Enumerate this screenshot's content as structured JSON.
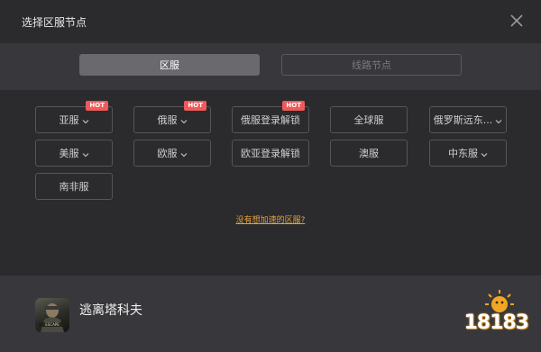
{
  "dialog": {
    "title": "选择区服节点"
  },
  "tabs": [
    {
      "label": "区服",
      "active": true
    },
    {
      "label": "线路节点",
      "active": false
    }
  ],
  "regions": [
    {
      "label": "亚服",
      "dropdown": true,
      "hot": true
    },
    {
      "label": "俄服",
      "dropdown": true,
      "hot": true
    },
    {
      "label": "俄服登录解锁",
      "dropdown": false,
      "hot": true
    },
    {
      "label": "全球服",
      "dropdown": false,
      "hot": false
    },
    {
      "label": "俄罗斯远东...",
      "dropdown": true,
      "hot": false
    },
    {
      "label": "美服",
      "dropdown": true,
      "hot": false
    },
    {
      "label": "欧服",
      "dropdown": true,
      "hot": false
    },
    {
      "label": "欧亚登录解锁",
      "dropdown": false,
      "hot": false
    },
    {
      "label": "澳服",
      "dropdown": false,
      "hot": false
    },
    {
      "label": "中东服",
      "dropdown": true,
      "hot": false
    },
    {
      "label": "南非服",
      "dropdown": false,
      "hot": false
    }
  ],
  "hot_badge": "HOT",
  "help_link": "没有想加速的区服?",
  "game": {
    "name": "逃离塔科夫",
    "icon": "game-cover-icon"
  },
  "brand": {
    "text": "18183"
  },
  "colors": {
    "background": "#2b2b2e",
    "panel": "#38383c",
    "accent_link": "#e5a23a",
    "hot": "#f15a5a"
  }
}
